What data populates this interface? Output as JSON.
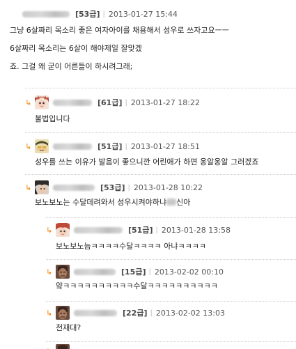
{
  "comments": [
    {
      "grade": "[53급]",
      "time": "2013-01-27 15:44",
      "lines": [
        "그냥 6살짜리 목소리 좋은 여자아이를 채용해서 성우로 쓰자고요ㅡㅡ",
        "6살짜리 목소리는 6살이 해야제일 잘맞겠",
        "죠. 그걸 왜 굳이 어른들이 하시려그래;"
      ]
    },
    {
      "grade": "[61급]",
      "time": "2013-01-27 18:22",
      "lines": [
        "불법입니다"
      ]
    },
    {
      "grade": "[51급]",
      "time": "2013-01-27 18:51",
      "lines": [
        "성우를 쓰는 이유가 발음이 좋으니깐 어린애가 하면 옹알옹알 그러겠죠"
      ]
    },
    {
      "grade": "[53급]",
      "time": "2013-01-28 10:22",
      "text_before": "보노보노는 수달데려와서 성우시켜야하냐",
      "text_after": "신아"
    },
    {
      "grade": "[51급]",
      "time": "2013-01-28 13:58",
      "lines": [
        "보노보노늠ㅋㅋㅋㅋ수달ㅋㅋㅋㅋ 아냐ㅋㅋㅋㅋ"
      ]
    },
    {
      "grade": "[15급]",
      "time": "2013-02-02 00:10",
      "lines": [
        "얔ㅋㅋㅋㅋㅋㅋㅋㅋㅋㅋ수달ㅋㅋㅋㅋㅋㅋㅋㅋㅋㅋ"
      ]
    },
    {
      "grade": "[22급]",
      "time": "2013-02-02 13:03",
      "lines": [
        "천재대?"
      ]
    }
  ],
  "reply_arrow": "↳",
  "separator": "|",
  "icons": {
    "avatar_fox": "fox-girl-avatar-icon",
    "avatar_hat": "hat-character-avatar-icon",
    "avatar_dark": "dark-hair-avatar-icon",
    "avatar_red": "red-hair-avatar-icon",
    "avatar_warrior": "warrior-avatar-icon"
  }
}
